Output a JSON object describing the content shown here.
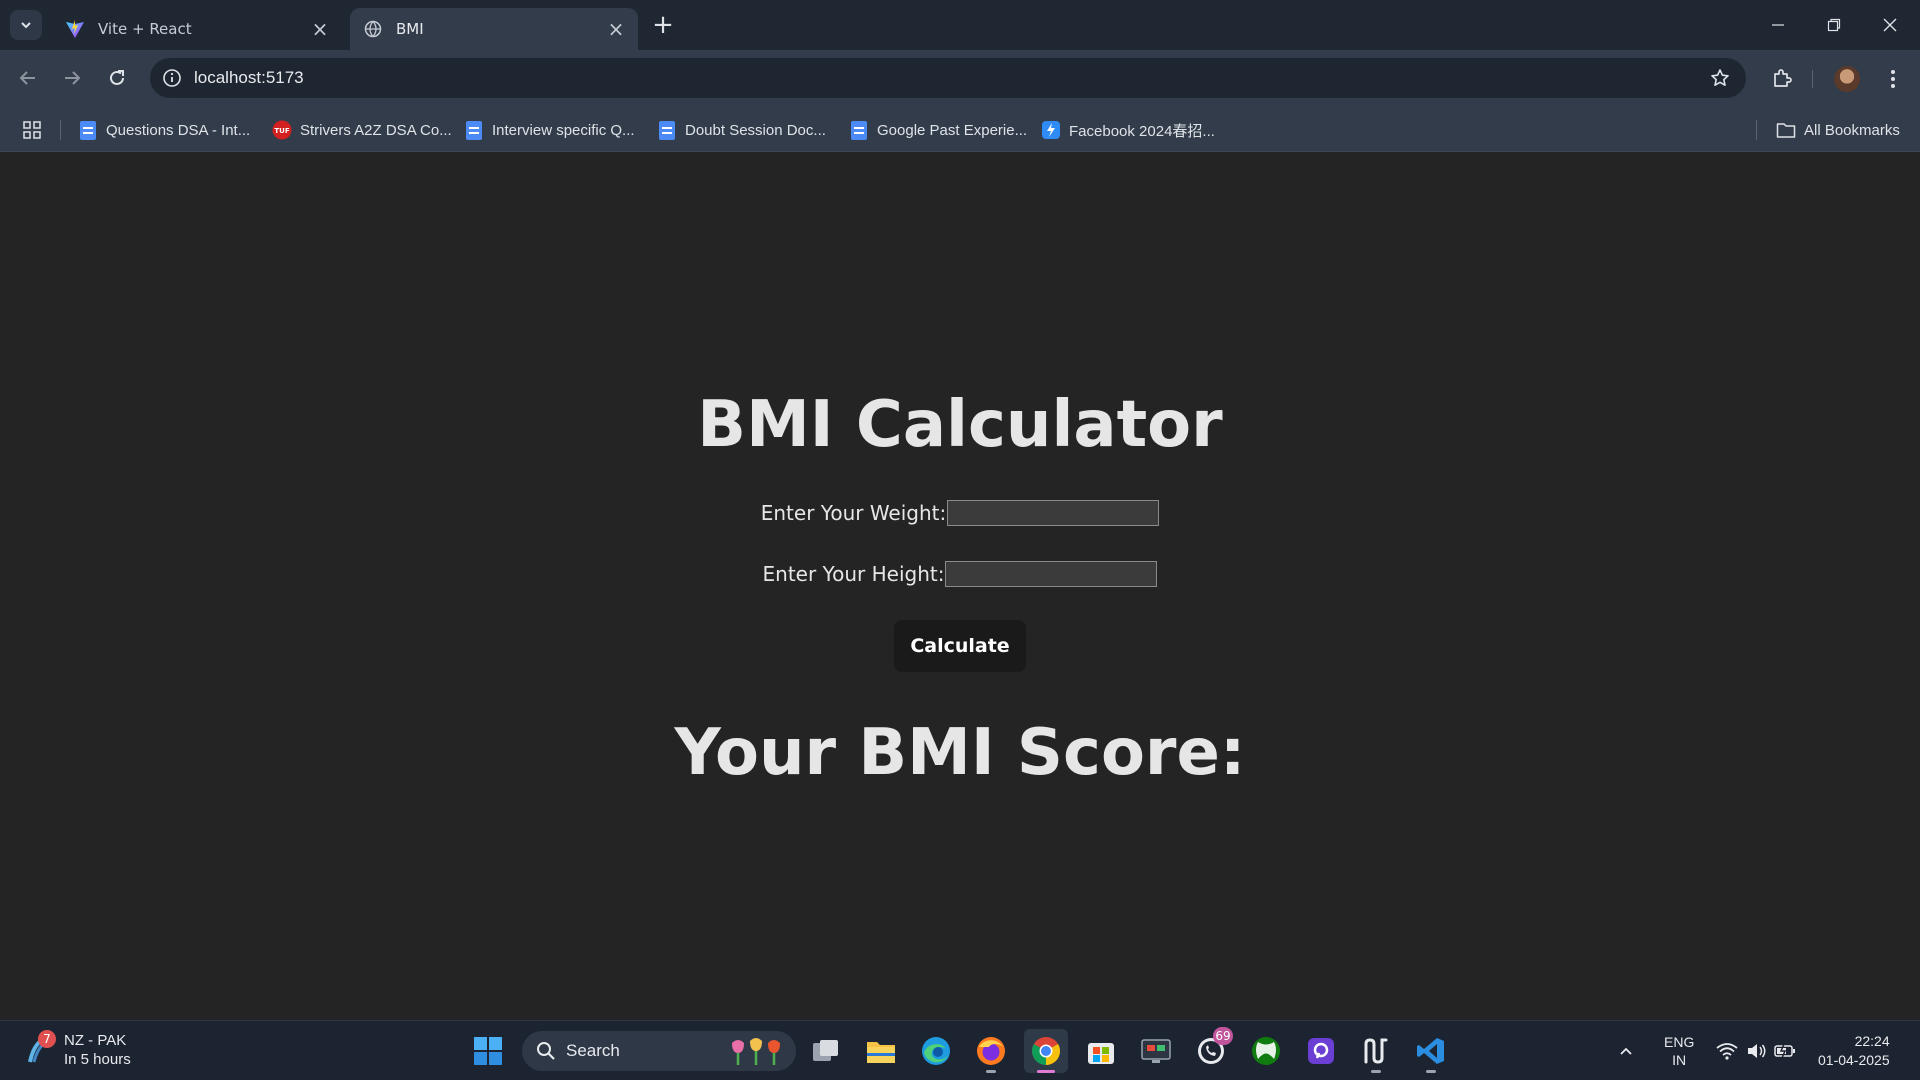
{
  "browser": {
    "tabs": [
      {
        "title": "Vite + React",
        "active": false,
        "icon": "vite-icon"
      },
      {
        "title": "BMI",
        "active": true,
        "icon": "globe-icon"
      }
    ],
    "url": "localhost:5173",
    "bookmarks": [
      {
        "label": "Questions DSA - Int...",
        "icon": "google-docs-icon"
      },
      {
        "label": "Strivers A2Z DSA Co...",
        "icon": "tuf-icon"
      },
      {
        "label": "Interview specific Q...",
        "icon": "google-docs-icon"
      },
      {
        "label": "Doubt Session Doc...",
        "icon": "google-docs-icon"
      },
      {
        "label": "Google Past Experie...",
        "icon": "google-docs-icon"
      },
      {
        "label": "Facebook 2024春招...",
        "icon": "feishu-icon"
      }
    ],
    "all_bookmarks_label": "All Bookmarks"
  },
  "page": {
    "title": "BMI Calculator",
    "weight_label": "Enter Your Weight:",
    "weight_value": "",
    "height_label": "Enter Your Height:",
    "height_value": "",
    "calculate_label": "Calculate",
    "score_label": "Your BMI Score:"
  },
  "taskbar": {
    "weather": {
      "badge": "7",
      "line1": "NZ - PAK",
      "line2": "In 5 hours"
    },
    "search_placeholder": "Search",
    "whatsapp_badge": "69",
    "lang_line1": "ENG",
    "lang_line2": "IN",
    "time": "22:24",
    "date": "01-04-2025"
  },
  "colors": {
    "page_bg": "#242424",
    "chrome_bg": "#323c4a",
    "tabstrip_bg": "#1f2733",
    "button_bg": "#1a1a1a",
    "taskbar_bg": "#1c2431"
  }
}
